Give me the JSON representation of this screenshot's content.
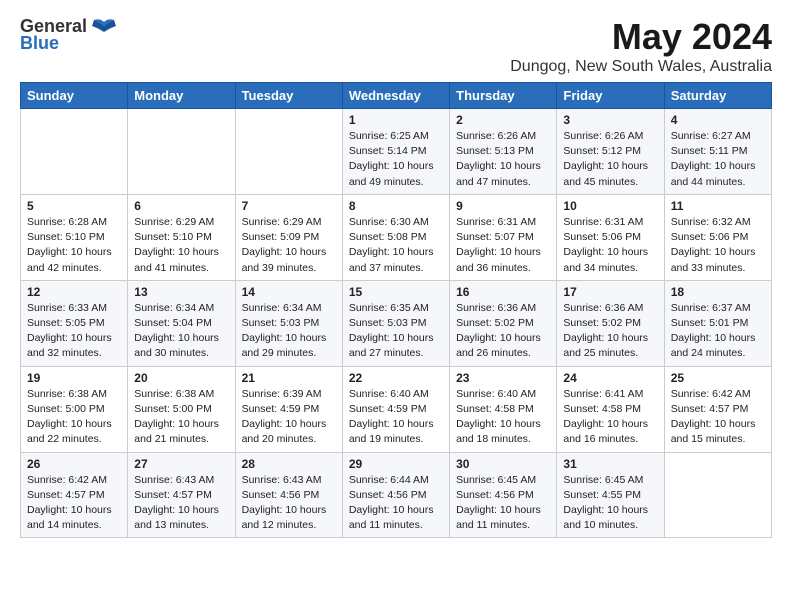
{
  "logo": {
    "general": "General",
    "blue": "Blue"
  },
  "title": "May 2024",
  "location": "Dungog, New South Wales, Australia",
  "days_of_week": [
    "Sunday",
    "Monday",
    "Tuesday",
    "Wednesday",
    "Thursday",
    "Friday",
    "Saturday"
  ],
  "weeks": [
    [
      {
        "day": "",
        "info": ""
      },
      {
        "day": "",
        "info": ""
      },
      {
        "day": "",
        "info": ""
      },
      {
        "day": "1",
        "info": "Sunrise: 6:25 AM\nSunset: 5:14 PM\nDaylight: 10 hours\nand 49 minutes."
      },
      {
        "day": "2",
        "info": "Sunrise: 6:26 AM\nSunset: 5:13 PM\nDaylight: 10 hours\nand 47 minutes."
      },
      {
        "day": "3",
        "info": "Sunrise: 6:26 AM\nSunset: 5:12 PM\nDaylight: 10 hours\nand 45 minutes."
      },
      {
        "day": "4",
        "info": "Sunrise: 6:27 AM\nSunset: 5:11 PM\nDaylight: 10 hours\nand 44 minutes."
      }
    ],
    [
      {
        "day": "5",
        "info": "Sunrise: 6:28 AM\nSunset: 5:10 PM\nDaylight: 10 hours\nand 42 minutes."
      },
      {
        "day": "6",
        "info": "Sunrise: 6:29 AM\nSunset: 5:10 PM\nDaylight: 10 hours\nand 41 minutes."
      },
      {
        "day": "7",
        "info": "Sunrise: 6:29 AM\nSunset: 5:09 PM\nDaylight: 10 hours\nand 39 minutes."
      },
      {
        "day": "8",
        "info": "Sunrise: 6:30 AM\nSunset: 5:08 PM\nDaylight: 10 hours\nand 37 minutes."
      },
      {
        "day": "9",
        "info": "Sunrise: 6:31 AM\nSunset: 5:07 PM\nDaylight: 10 hours\nand 36 minutes."
      },
      {
        "day": "10",
        "info": "Sunrise: 6:31 AM\nSunset: 5:06 PM\nDaylight: 10 hours\nand 34 minutes."
      },
      {
        "day": "11",
        "info": "Sunrise: 6:32 AM\nSunset: 5:06 PM\nDaylight: 10 hours\nand 33 minutes."
      }
    ],
    [
      {
        "day": "12",
        "info": "Sunrise: 6:33 AM\nSunset: 5:05 PM\nDaylight: 10 hours\nand 32 minutes."
      },
      {
        "day": "13",
        "info": "Sunrise: 6:34 AM\nSunset: 5:04 PM\nDaylight: 10 hours\nand 30 minutes."
      },
      {
        "day": "14",
        "info": "Sunrise: 6:34 AM\nSunset: 5:03 PM\nDaylight: 10 hours\nand 29 minutes."
      },
      {
        "day": "15",
        "info": "Sunrise: 6:35 AM\nSunset: 5:03 PM\nDaylight: 10 hours\nand 27 minutes."
      },
      {
        "day": "16",
        "info": "Sunrise: 6:36 AM\nSunset: 5:02 PM\nDaylight: 10 hours\nand 26 minutes."
      },
      {
        "day": "17",
        "info": "Sunrise: 6:36 AM\nSunset: 5:02 PM\nDaylight: 10 hours\nand 25 minutes."
      },
      {
        "day": "18",
        "info": "Sunrise: 6:37 AM\nSunset: 5:01 PM\nDaylight: 10 hours\nand 24 minutes."
      }
    ],
    [
      {
        "day": "19",
        "info": "Sunrise: 6:38 AM\nSunset: 5:00 PM\nDaylight: 10 hours\nand 22 minutes."
      },
      {
        "day": "20",
        "info": "Sunrise: 6:38 AM\nSunset: 5:00 PM\nDaylight: 10 hours\nand 21 minutes."
      },
      {
        "day": "21",
        "info": "Sunrise: 6:39 AM\nSunset: 4:59 PM\nDaylight: 10 hours\nand 20 minutes."
      },
      {
        "day": "22",
        "info": "Sunrise: 6:40 AM\nSunset: 4:59 PM\nDaylight: 10 hours\nand 19 minutes."
      },
      {
        "day": "23",
        "info": "Sunrise: 6:40 AM\nSunset: 4:58 PM\nDaylight: 10 hours\nand 18 minutes."
      },
      {
        "day": "24",
        "info": "Sunrise: 6:41 AM\nSunset: 4:58 PM\nDaylight: 10 hours\nand 16 minutes."
      },
      {
        "day": "25",
        "info": "Sunrise: 6:42 AM\nSunset: 4:57 PM\nDaylight: 10 hours\nand 15 minutes."
      }
    ],
    [
      {
        "day": "26",
        "info": "Sunrise: 6:42 AM\nSunset: 4:57 PM\nDaylight: 10 hours\nand 14 minutes."
      },
      {
        "day": "27",
        "info": "Sunrise: 6:43 AM\nSunset: 4:57 PM\nDaylight: 10 hours\nand 13 minutes."
      },
      {
        "day": "28",
        "info": "Sunrise: 6:43 AM\nSunset: 4:56 PM\nDaylight: 10 hours\nand 12 minutes."
      },
      {
        "day": "29",
        "info": "Sunrise: 6:44 AM\nSunset: 4:56 PM\nDaylight: 10 hours\nand 11 minutes."
      },
      {
        "day": "30",
        "info": "Sunrise: 6:45 AM\nSunset: 4:56 PM\nDaylight: 10 hours\nand 11 minutes."
      },
      {
        "day": "31",
        "info": "Sunrise: 6:45 AM\nSunset: 4:55 PM\nDaylight: 10 hours\nand 10 minutes."
      },
      {
        "day": "",
        "info": ""
      }
    ]
  ]
}
